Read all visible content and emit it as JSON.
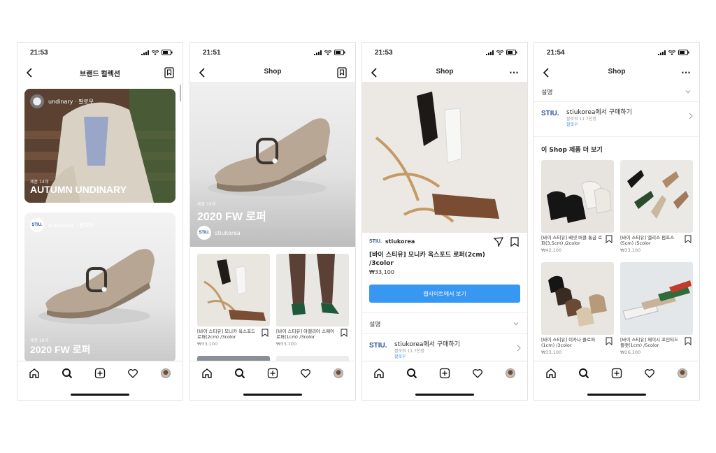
{
  "screens": [
    {
      "time": "21:53",
      "title": "브랜드 컬렉션",
      "cards": [
        {
          "user": "undinary · 팔로우",
          "small": "제품 14개",
          "big": "AUTUMN UNDINARY"
        },
        {
          "user": "stiukorea · 팔로우",
          "logo": "STIU.",
          "small": "제품 19개",
          "big": "2020 FW 로퍼"
        }
      ]
    },
    {
      "time": "21:51",
      "title": "Shop",
      "hero": {
        "small": "제품 19개",
        "big": "2020 FW 로퍼",
        "logo": "STIU.",
        "brand": "stiukorea"
      },
      "products": [
        {
          "name": "[바이 스티유] 모니카 옥스포드 로퍼(2cm) /3color",
          "price": "₩33,100"
        },
        {
          "name": "[바이 스티유] 아멜리아 스웨이 로퍼(1cm) /3color",
          "price": "₩33,100"
        }
      ]
    },
    {
      "time": "21:53",
      "title": "Shop",
      "more": "···",
      "logo": "STIU.",
      "brand": "stiukorea",
      "product_name": "[바이 스티유] 모니카 옥스포드 로퍼(2cm) /3color",
      "price": "₩33,100",
      "button": "웹사이트에서 보기",
      "section": "설명",
      "shop_logo": "STIU.",
      "shop_text": "stiukorea에서 구매하기",
      "shop_sub": "팔로워 11.7천명",
      "shop_follow": "팔로우"
    },
    {
      "time": "21:54",
      "title": "Shop",
      "more": "···",
      "section": "설명",
      "shop_logo": "STIU.",
      "shop_text": "stiukorea에서 구매하기",
      "shop_sub": "팔로워 11.7천명",
      "shop_follow": "팔로우",
      "more_heading": "이 Shop 제품 더 보기",
      "products": [
        {
          "name": "[바이 스티유] 베넷 버클 통굽 로퍼(3.5cm) /2color",
          "price": "₩42,100"
        },
        {
          "name": "[바이 스티유] 엘리스 펌프스(5cm) /5color",
          "price": "₩33,100"
        },
        {
          "name": "[바이 스티유] 미카나 플로퍼(1cm) /3color",
          "price": "₩33,100"
        },
        {
          "name": "[바이 스티유] 제이시 포인티드 플랫(1cm) /5color",
          "price": "₩26,100"
        }
      ]
    }
  ],
  "colors": {
    "accent": "#3897f0",
    "brand": "#2b4f9b"
  }
}
